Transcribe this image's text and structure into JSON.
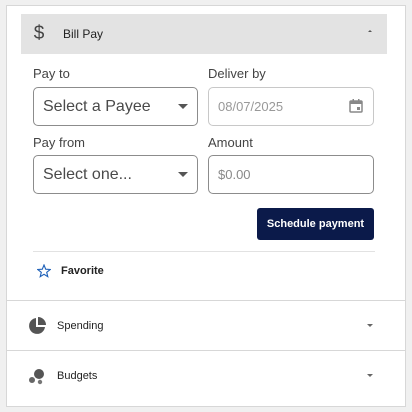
{
  "bill_pay": {
    "title": "Bill Pay",
    "icon": "dollar-icon",
    "pay_to": {
      "label": "Pay to",
      "value": "Select a Payee"
    },
    "deliver_by": {
      "label": "Deliver by",
      "value": "08/07/2025"
    },
    "pay_from": {
      "label": "Pay from",
      "value": "Select one..."
    },
    "amount": {
      "label": "Amount",
      "placeholder": "$0.00"
    },
    "schedule_label": "Schedule payment",
    "favorite_label": "Favorite"
  },
  "sections": [
    {
      "label": "Spending",
      "icon": "pie-chart-icon"
    },
    {
      "label": "Budgets",
      "icon": "bubbles-icon"
    }
  ],
  "colors": {
    "primary_button": "#0b1a4a",
    "header_bg": "#e3e3e3",
    "favorite_star": "#1c5fb8"
  }
}
